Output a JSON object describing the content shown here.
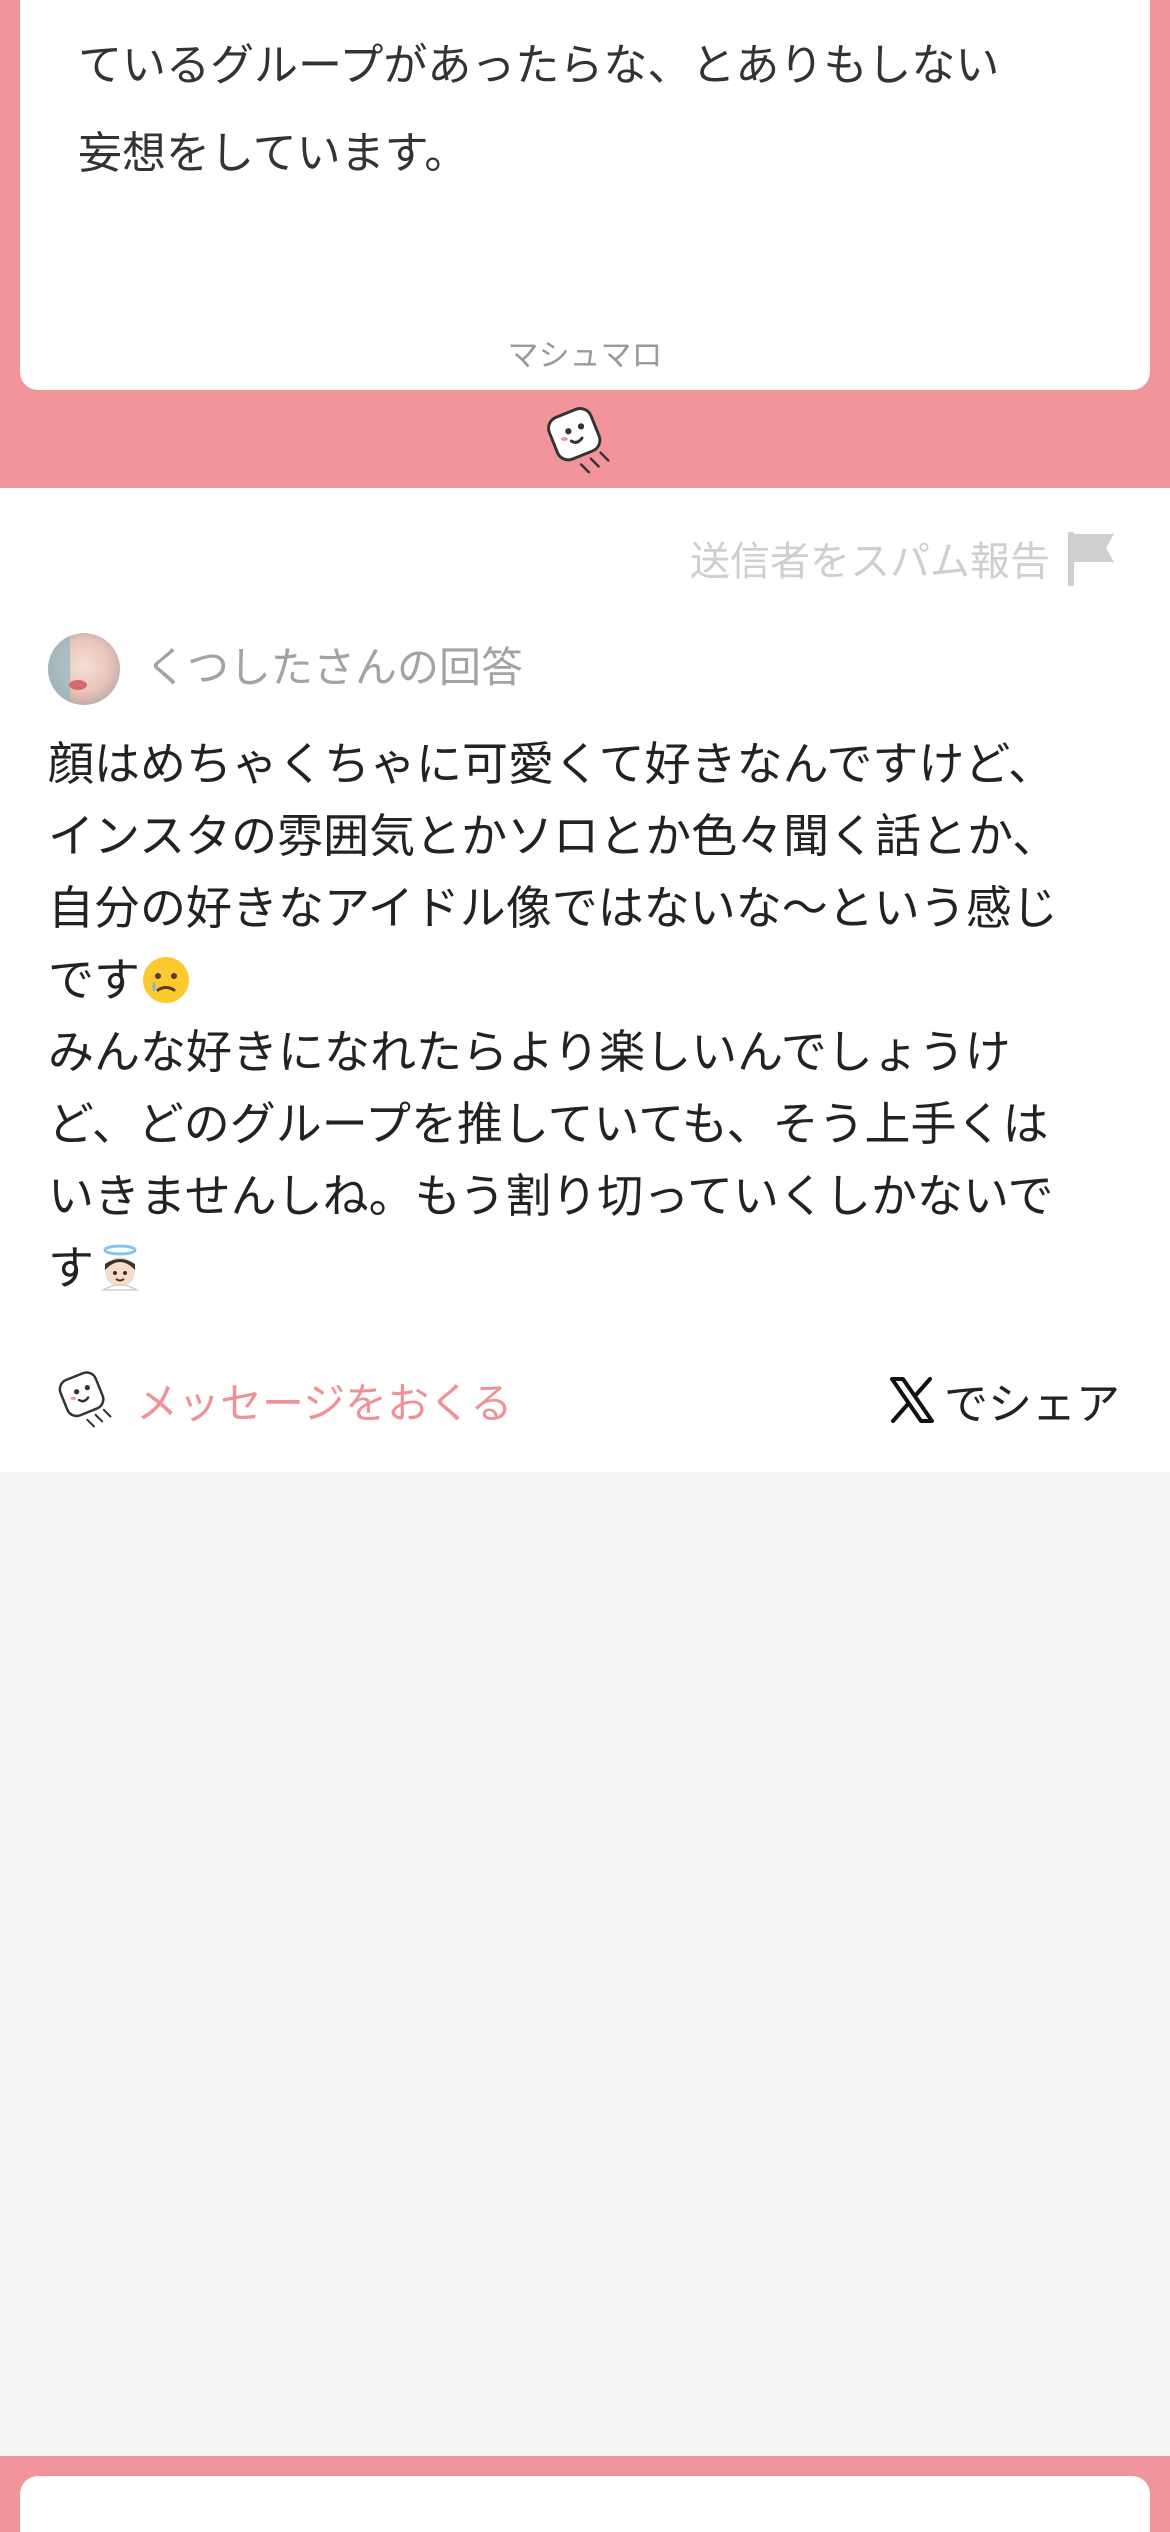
{
  "question": {
    "text": "ているグループがあったらな、とありもしない\n妄想をしています。",
    "brand": "マシュマロ"
  },
  "answer": {
    "spam_report_label": "送信者をスパム報告",
    "answerer_label": "くつしたさんの回答",
    "text_part1": "顔はめちゃくちゃに可愛くて好きなんですけど、\nインスタの雰囲気とかソロとか色々聞く話とか、\n自分の好きなアイドル像ではないな〜という感じ\nです",
    "text_part2": "\nみんな好きになれたらより楽しいんでしょうけ\nど、どのグループを推していても、そう上手くは\nいきませんしね。もう割り切っていくしかないで\nす",
    "emoji_1": "face-holding-back-tears",
    "emoji_2": "smiling-face-with-halo"
  },
  "actions": {
    "send_message_label": "メッセージをおくる",
    "share_label": "でシェア"
  },
  "colors": {
    "brand_pink": "#f2959a",
    "send_pink": "#ee9298"
  },
  "icons": [
    "marshmallow-mascot-icon",
    "flag-icon",
    "x-logo-icon"
  ]
}
